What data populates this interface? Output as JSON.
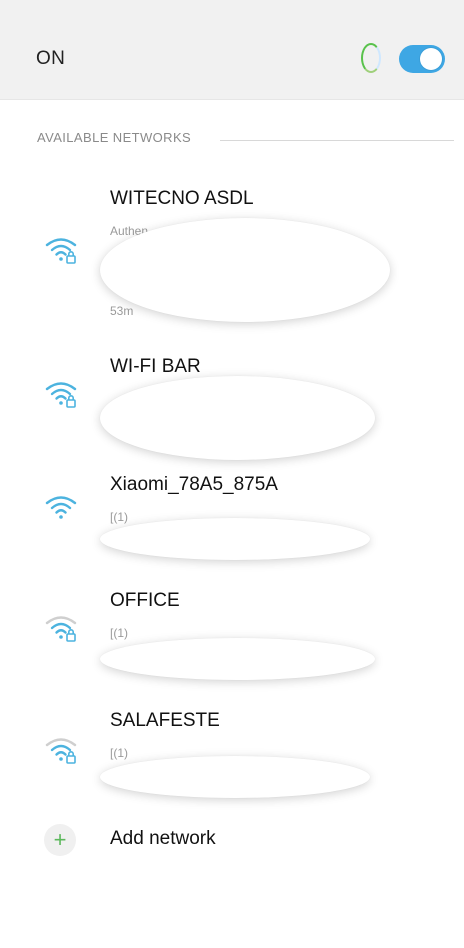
{
  "toggle_row": {
    "label": "ON",
    "toggle_state": "on",
    "accent_color": "#3ea7e4"
  },
  "section": {
    "title": "AVAILABLE NETWORKS"
  },
  "networks": [
    {
      "name": "WITECNO ASDL",
      "line1": "Authen",
      "line1b": "",
      "line2": "53m",
      "icon": "wifi-locked-icon",
      "signal": "strong"
    },
    {
      "name": "WI-FI BAR",
      "line1": "",
      "icon": "wifi-locked-icon",
      "signal": "strong"
    },
    {
      "name": "Xiaomi_78A5_875A",
      "line1": "[(1)",
      "icon": "wifi-icon",
      "signal": "strong"
    },
    {
      "name": "OFFICE",
      "line1": "[(1)",
      "icon": "wifi-locked-icon",
      "signal": "weak"
    },
    {
      "name": "SALAFESTE",
      "line1": "[(1)",
      "icon": "wifi-locked-icon",
      "signal": "weak"
    }
  ],
  "add_network": {
    "label": "Add network",
    "icon": "plus-icon"
  }
}
